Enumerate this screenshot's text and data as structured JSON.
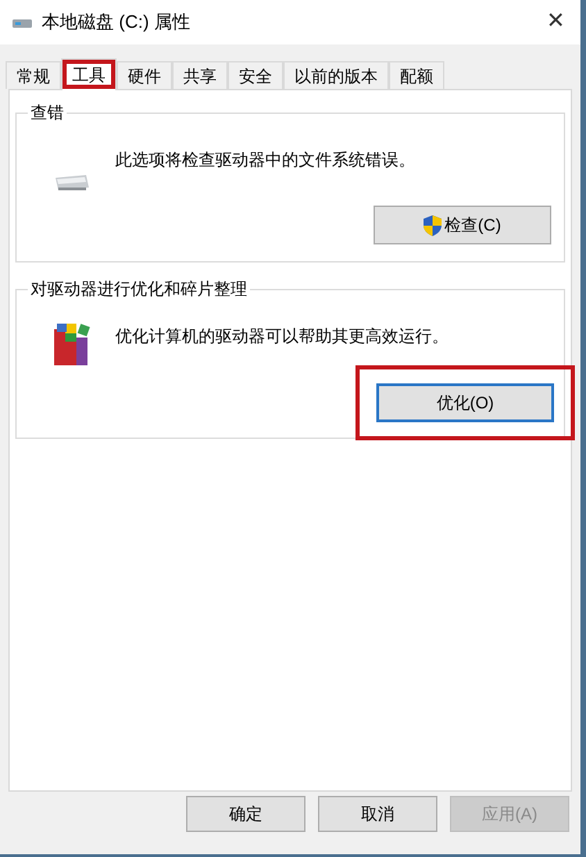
{
  "window": {
    "title": "本地磁盘 (C:) 属性",
    "close": "✕"
  },
  "tabs": [
    {
      "label": "常规",
      "selected": false,
      "highlighted": false
    },
    {
      "label": "工具",
      "selected": true,
      "highlighted": true
    },
    {
      "label": "硬件",
      "selected": false,
      "highlighted": false
    },
    {
      "label": "共享",
      "selected": false,
      "highlighted": false
    },
    {
      "label": "安全",
      "selected": false,
      "highlighted": false
    },
    {
      "label": "以前的版本",
      "selected": false,
      "highlighted": false
    },
    {
      "label": "配额",
      "selected": false,
      "highlighted": false
    }
  ],
  "groups": [
    {
      "kind": "check",
      "title": "查错",
      "description": "此选项将检查驱动器中的文件系统错误。",
      "button": {
        "label": "检查(C)",
        "shield": true,
        "focused": false,
        "highlighted": false
      }
    },
    {
      "kind": "optimize",
      "title": "对驱动器进行优化和碎片整理",
      "description": "优化计算机的驱动器可以帮助其更高效运行。",
      "button": {
        "label": "优化(O)",
        "shield": false,
        "focused": true,
        "highlighted": true
      }
    }
  ],
  "buttons": [
    {
      "label": "确定",
      "disabled": false
    },
    {
      "label": "取消",
      "disabled": false
    },
    {
      "label": "应用(A)",
      "disabled": true
    }
  ]
}
